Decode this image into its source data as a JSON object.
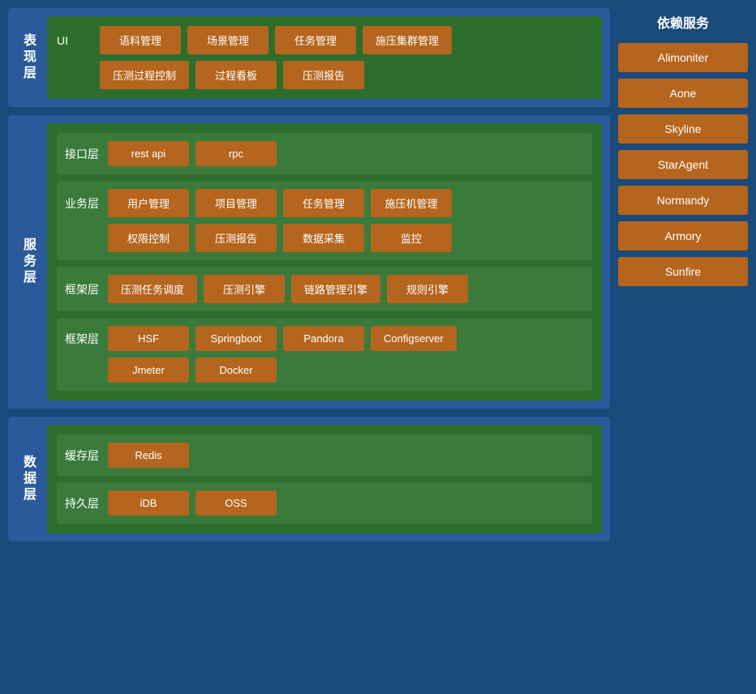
{
  "layers": {
    "presentation": {
      "label": "表现层",
      "inner_label": "UI",
      "rows": [
        [
          "语料管理",
          "场景管理",
          "任务管理",
          "施压集群管理"
        ],
        [
          "压测过程控制",
          "过程看板",
          "压测报告"
        ]
      ]
    },
    "service": {
      "label": "服务层",
      "sublayers": [
        {
          "label": "接口层",
          "rows": [
            [
              "rest api",
              "rpc"
            ]
          ]
        },
        {
          "label": "业务层",
          "rows": [
            [
              "用户管理",
              "项目管理",
              "任务管理",
              "施压机管理"
            ],
            [
              "权限控制",
              "压测报告",
              "数据采集",
              "监控"
            ]
          ]
        },
        {
          "label": "框架层",
          "rows": [
            [
              "压测任务调度",
              "压测引擎",
              "链路管理引擎",
              "规则引擎"
            ]
          ]
        },
        {
          "label": "框架层",
          "rows": [
            [
              "HSF",
              "Springboot",
              "Pandora",
              "Configserver"
            ],
            [
              "Jmeter",
              "Docker"
            ]
          ]
        }
      ]
    },
    "data": {
      "label": "数据层",
      "sublayers": [
        {
          "label": "缓存层",
          "rows": [
            [
              "Redis"
            ]
          ]
        },
        {
          "label": "持久层",
          "rows": [
            [
              "iDB",
              "OSS"
            ]
          ]
        }
      ]
    }
  },
  "sidebar": {
    "title": "依赖服务",
    "items": [
      "Alimoniter",
      "Aone",
      "Skyline",
      "StarAgent",
      "Normandy",
      "Armory",
      "Sunfire"
    ]
  }
}
